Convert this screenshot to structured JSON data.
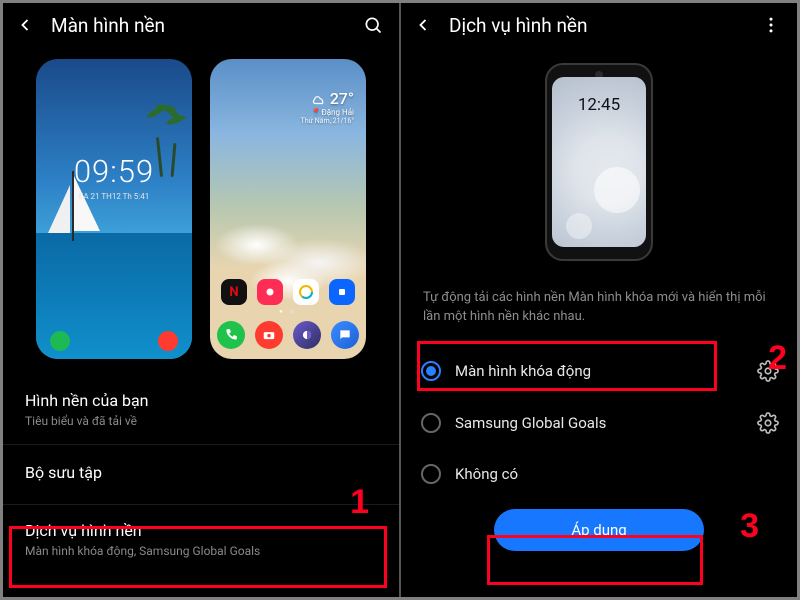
{
  "left": {
    "header_title": "Màn hình nền",
    "lock_preview": {
      "time": "09:59",
      "date": "EA 21 TH12 Th 5:41"
    },
    "home_preview": {
      "temp": "27°",
      "location": "Đặng Hải",
      "range": "Thứ Năm, 21/16°"
    },
    "sections": {
      "your_wallpaper_title": "Hình nền của bạn",
      "your_wallpaper_sub": "Tiêu biểu và đã tải về",
      "collection_title": "Bộ sưu tập",
      "service_title": "Dịch vụ hình nền",
      "service_sub": "Màn hình khóa động, Samsung Global Goals"
    }
  },
  "right": {
    "header_title": "Dịch vụ hình nền",
    "mini_clock": "12:45",
    "description": "Tự động tải các hình nền Màn hình khóa mới và hiển thị mỗi lần một hình nền khác nhau.",
    "options": [
      {
        "label": "Màn hình khóa động",
        "checked": true,
        "has_gear": true
      },
      {
        "label": "Samsung Global Goals",
        "checked": false,
        "has_gear": true
      },
      {
        "label": "Không có",
        "checked": false,
        "has_gear": false
      }
    ],
    "apply_label": "Áp dụng"
  },
  "steps": {
    "one": "1",
    "two": "2",
    "three": "3"
  }
}
